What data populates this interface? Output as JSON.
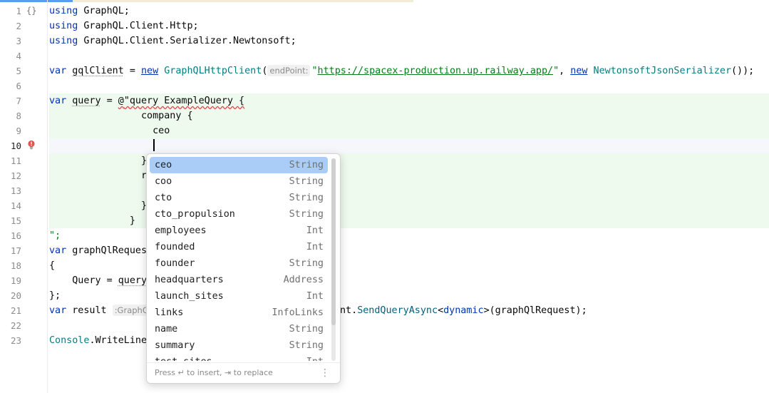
{
  "editor": {
    "line_numbers": [
      "1",
      "2",
      "3",
      "4",
      "5",
      "6",
      "7",
      "8",
      "9",
      "10",
      "11",
      "12",
      "13",
      "14",
      "15",
      "16",
      "17",
      "18",
      "19",
      "20",
      "21",
      "22",
      "23"
    ],
    "fold_glyph": "{}",
    "lines": {
      "l1_kw": "using",
      "l1_rest": " GraphQL;",
      "l2_kw": "using",
      "l2_rest": " GraphQL.Client.Http;",
      "l3_kw": "using",
      "l3_rest": " GraphQL.Client.Serializer.Newtonsoft;",
      "l5_kw": "var",
      "l5_var": "gqlClient",
      "l5_eq": " = ",
      "l5_new": "new",
      "l5_sp": " ",
      "l5_type": "GraphQLHttpClient",
      "l5_paren": "(",
      "l5_hint": "endPoint:",
      "l5_q1": "\"",
      "l5_url": "https://spacex-production.up.railway.app/",
      "l5_q2": "\"",
      "l5_comma": ", ",
      "l5_new2": "new",
      "l5_sp2": " ",
      "l5_type2": "NewtonsoftJsonSerializer",
      "l5_end": "());",
      "l7_kw": "var",
      "l7_sp": " ",
      "l7_var": "query",
      "l7_eq": " = ",
      "l7_at": "@",
      "l7_str": "\"query ExampleQuery {",
      "l8": "                company {",
      "l9": "                  ceo",
      "l11": "                }",
      "l12": "                r",
      "l14": "                }",
      "l15": "              }",
      "l16": "\";",
      "l17_kw": "var",
      "l17_rest": " graphQlReques",
      "l18": "{",
      "l19_pre": "    Query = ",
      "l19_var": "query",
      "l20": "};",
      "l21_kw": "var",
      "l21_var": " result",
      "l21_hint": ":GraphQ",
      "l21_tail_a": "nt.",
      "l21_meth": "SendQueryAsync",
      "l21_lt": "<",
      "l21_dyn": "dynamic",
      "l21_tail_b": ">(graphQlRequest);",
      "l23_type": "Console",
      "l23_rest": ".WriteLine"
    }
  },
  "completion": {
    "items": [
      {
        "name": "ceo",
        "type": "String"
      },
      {
        "name": "coo",
        "type": "String"
      },
      {
        "name": "cto",
        "type": "String"
      },
      {
        "name": "cto_propulsion",
        "type": "String"
      },
      {
        "name": "employees",
        "type": "Int"
      },
      {
        "name": "founded",
        "type": "Int"
      },
      {
        "name": "founder",
        "type": "String"
      },
      {
        "name": "headquarters",
        "type": "Address"
      },
      {
        "name": "launch_sites",
        "type": "Int"
      },
      {
        "name": "links",
        "type": "InfoLinks"
      },
      {
        "name": "name",
        "type": "String"
      },
      {
        "name": "summary",
        "type": "String"
      },
      {
        "name": "test_sites",
        "type": "Int"
      }
    ],
    "footer": "Press ↵ to insert, ⇥ to replace",
    "more_glyph": "⋮"
  }
}
